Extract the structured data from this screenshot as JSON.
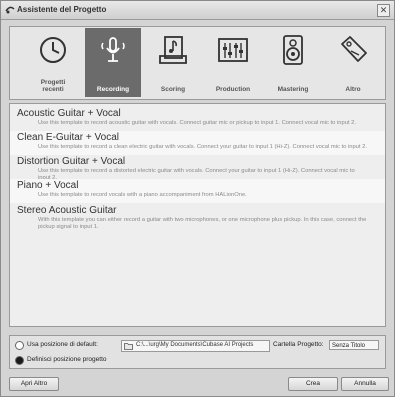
{
  "window": {
    "title": "Assistente del Progetto",
    "close_glyph": "✕"
  },
  "categories": [
    {
      "label": "Progetti\nrecenti",
      "icon": "clock-icon",
      "active": false
    },
    {
      "label": "Recording",
      "icon": "microphone-icon",
      "active": true
    },
    {
      "label": "Scoring",
      "icon": "sheet-music-icon",
      "active": false
    },
    {
      "label": "Production",
      "icon": "mixer-faders-icon",
      "active": false
    },
    {
      "label": "Mastering",
      "icon": "speaker-icon",
      "active": false
    },
    {
      "label": "Altro",
      "icon": "tag-icon",
      "active": false
    }
  ],
  "templates": [
    {
      "title": "Acoustic Guitar + Vocal",
      "desc": "Use this template to record acoustic guitar with vocals. Connect guitar mic or pickup to input 1. Connect vocal mic to input 2."
    },
    {
      "title": "Clean E-Guitar + Vocal",
      "desc": "Use this template to record a clean electric guitar with vocals. Connect your guitar to input 1 (Hi-Z). Connect vocal mic to input 2."
    },
    {
      "title": "Distortion Guitar + Vocal",
      "desc": "Use this template to record a distorted electric guitar with vocals. Connect your guitar to input 1 (Hi-Z). Connect vocal mic to input 2."
    },
    {
      "title": "Piano + Vocal",
      "desc": "Use this template to record vocals with a piano accompaniment from HALionOne."
    },
    {
      "title": "Stereo Acoustic Guitar",
      "desc": "With this template you can either record a guitar with two microphones, or one microphone plus pickup. In this case, connect the pickup signal to input 1."
    }
  ],
  "location": {
    "default_label": "Usa posizione di default:",
    "path": "C:\\...\\urg\\My Documents\\Cubase AI Projects",
    "folder_label": "Cartella Progetto:",
    "folder_value": "Senza Titolo",
    "custom_label": "Definisci posizione progetto"
  },
  "buttons": {
    "open_other": "Apri Altro",
    "create": "Crea",
    "cancel": "Annulla"
  }
}
